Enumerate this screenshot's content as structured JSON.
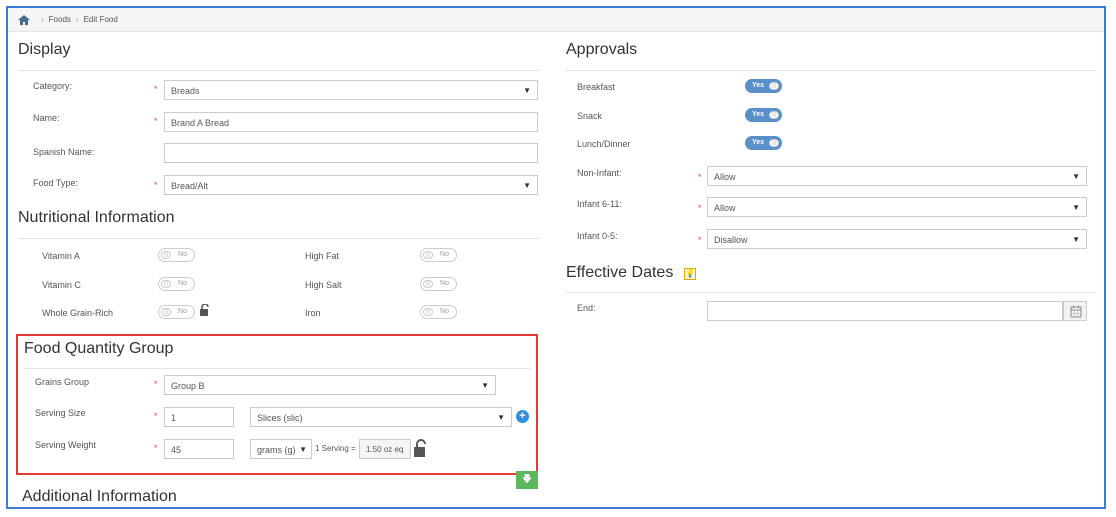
{
  "breadcrumb": {
    "items": [
      "Foods",
      "Edit Food"
    ]
  },
  "display": {
    "title": "Display",
    "category": {
      "label": "Category:",
      "value": "Breads"
    },
    "name": {
      "label": "Name:",
      "value": "Brand A Bread"
    },
    "spanish_name": {
      "label": "Spanish Name:",
      "value": ""
    },
    "food_type": {
      "label": "Food Type:",
      "value": "Bread/Alt"
    }
  },
  "nutrition": {
    "title": "Nutritional Information",
    "items": [
      {
        "label": "Vitamin A",
        "value": "No"
      },
      {
        "label": "High Fat",
        "value": "No"
      },
      {
        "label": "Vitamin C",
        "value": "No"
      },
      {
        "label": "High Salt",
        "value": "No"
      },
      {
        "label": "Whole Grain-Rich",
        "value": "No"
      },
      {
        "label": "Iron",
        "value": "No"
      }
    ]
  },
  "quantity": {
    "title": "Food Quantity Group",
    "grains_group": {
      "label": "Grains Group",
      "value": "Group B"
    },
    "serving_size": {
      "label": "Serving Size",
      "value": "1",
      "unit": "Slices (slic)"
    },
    "serving_weight": {
      "label": "Serving Weight",
      "value": "45",
      "unit": "grams (g)",
      "serving_text": "1 Serving =",
      "oz_value": "1.50",
      "oz_unit": "oz eq"
    }
  },
  "additional": {
    "title": "Additional Information"
  },
  "approvals": {
    "title": "Approvals",
    "breakfast": {
      "label": "Breakfast",
      "value": "Yes"
    },
    "snack": {
      "label": "Snack",
      "value": "Yes"
    },
    "lunch": {
      "label": "Lunch/Dinner",
      "value": "Yes"
    },
    "non_infant": {
      "label": "Non-Infant:",
      "value": "Allow"
    },
    "infant_6_11": {
      "label": "Infant 6-11:",
      "value": "Allow"
    },
    "infant_0_5": {
      "label": "Infant 0-5:",
      "value": "Disallow"
    }
  },
  "effective": {
    "title": "Effective Dates",
    "end": {
      "label": "End:",
      "value": ""
    }
  },
  "symbols": {
    "required": "*",
    "caret": "▼",
    "plus": "+",
    "down_arrow": "🡇",
    "bulb": "💡",
    "knob": "|||"
  },
  "colors": {
    "accent": "#3a7bd5",
    "highlight_border": "#e53935",
    "toggle_on": "#5b8fc9",
    "add_button": "#2f8fe0",
    "green_button": "#5cb85c"
  }
}
